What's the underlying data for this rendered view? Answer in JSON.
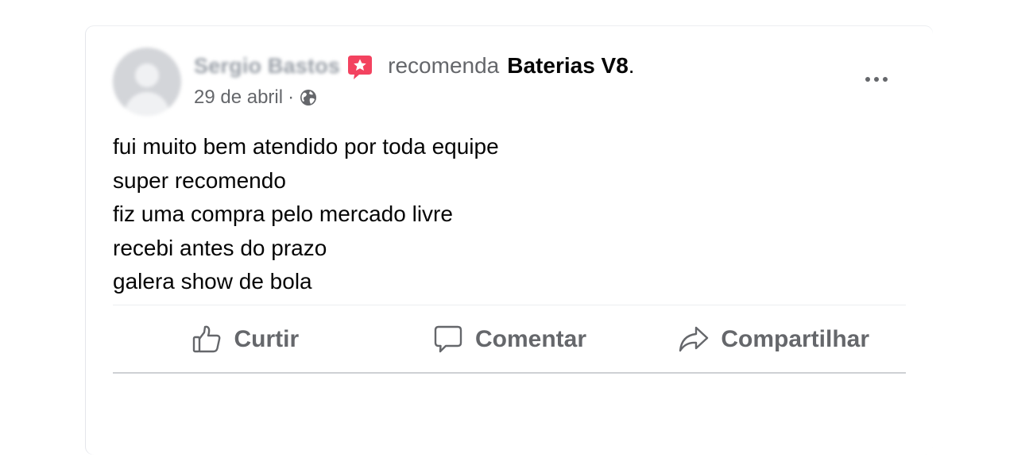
{
  "post": {
    "author": "Sergio Bastos",
    "verb": "recomenda",
    "page_name": "Baterias V8",
    "period": ".",
    "date": "29 de abril",
    "separator": "·",
    "audience_icon": "globe-icon",
    "badge_icon": "recommendation-star-icon",
    "menu_icon": "more-options-icon",
    "text_lines": [
      "fui muito bem atendido por toda equipe",
      "super recomendo",
      "fiz uma compra pelo mercado livre",
      "recebi antes do prazo",
      "galera show de bola"
    ]
  },
  "actions": [
    {
      "label": "Curtir",
      "icon": "like-icon"
    },
    {
      "label": "Comentar",
      "icon": "comment-icon"
    },
    {
      "label": "Compartilhar",
      "icon": "share-icon"
    }
  ],
  "colors": {
    "badge": "#f3425f",
    "secondary_text": "#65676b",
    "primary_text": "#050505",
    "divider": "#ced0d4"
  }
}
